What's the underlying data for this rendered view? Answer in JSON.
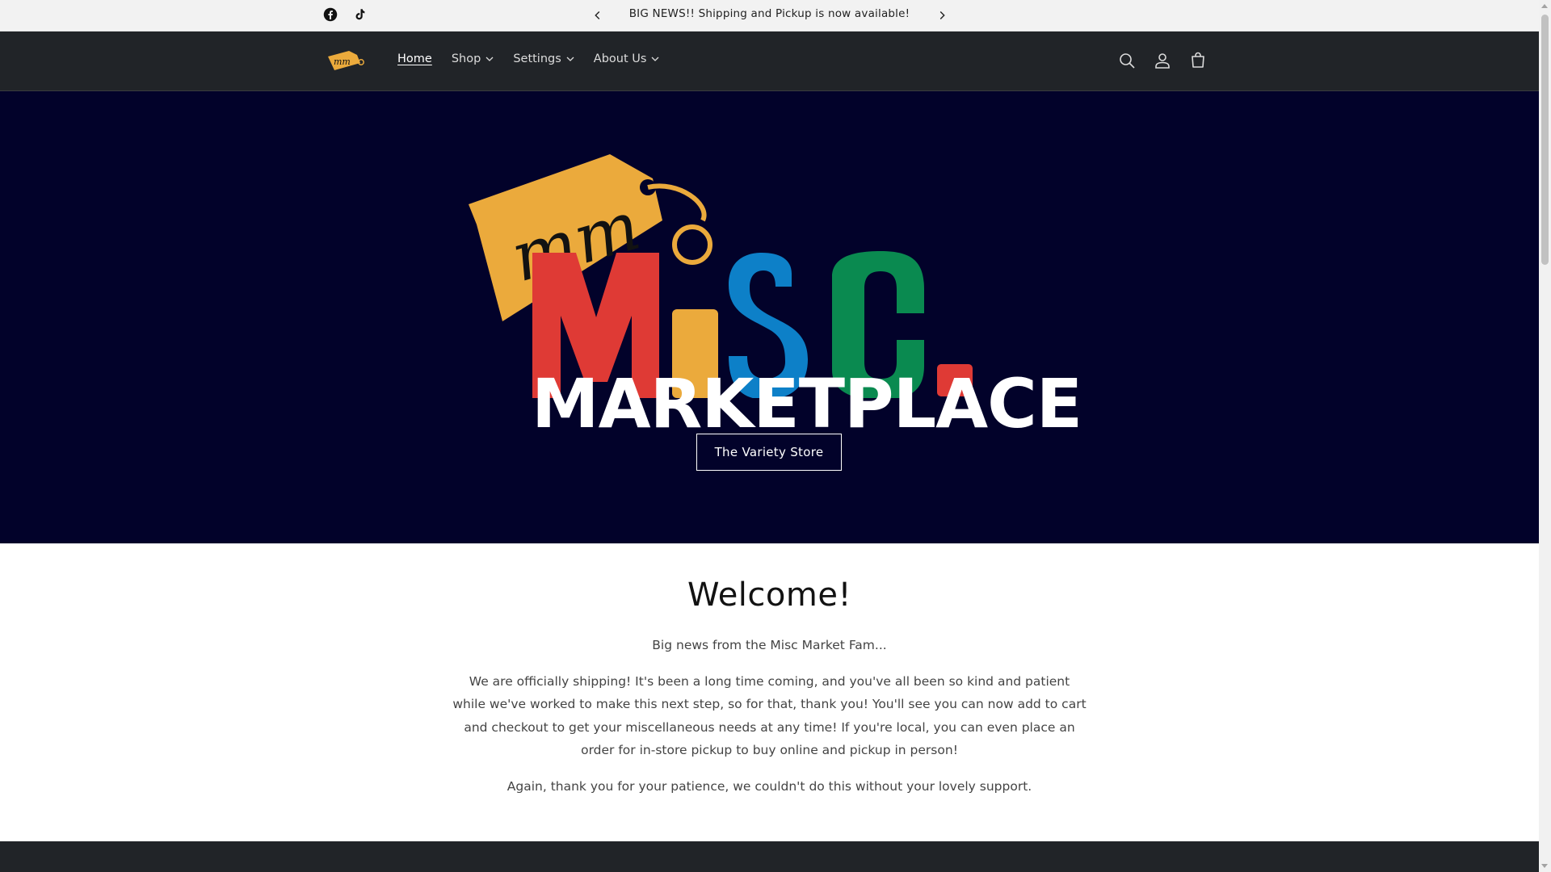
{
  "announcement": {
    "text": "BIG NEWS!! Shipping and Pickup is now available!"
  },
  "header": {
    "logo_text": "mm",
    "nav": [
      {
        "label": "Home",
        "active": true,
        "has_dropdown": false
      },
      {
        "label": "Shop",
        "active": false,
        "has_dropdown": true
      },
      {
        "label": "Settings",
        "active": false,
        "has_dropdown": true
      },
      {
        "label": "About Us",
        "active": false,
        "has_dropdown": true
      }
    ]
  },
  "hero": {
    "logo_tag_text": "mm",
    "logo_letters": "MiSC.",
    "wordmark": "MARKETPLACE",
    "button_label": "The Variety Store",
    "background": "#02022a"
  },
  "welcome": {
    "title": "Welcome!",
    "intro": "Big news from the Misc Market Fam...",
    "paragraph": "We are officially shipping! It's been a long time coming, and you've all been so kind and patient while we've worked to make this next step, so for that, thank you! You'll see you can now add to cart and checkout to get your miscellaneous needs at any time! If you're local, you can even place an order for in-store pickup to buy online and pickup in person!",
    "closing": "Again, thank you for your patience, we couldn't do this without your lovely support."
  },
  "colors": {
    "header_bg": "#212428",
    "tag_orange": "#ebaa3c",
    "letter_red": "#df3a35",
    "letter_yellow": "#ebaa3c",
    "letter_blue": "#0d80c8",
    "letter_green": "#0a8a50"
  },
  "icons": [
    "facebook-icon",
    "tiktok-icon",
    "chevron-left-icon",
    "chevron-right-icon",
    "search-icon",
    "account-icon",
    "cart-icon",
    "chevron-down-icon"
  ]
}
